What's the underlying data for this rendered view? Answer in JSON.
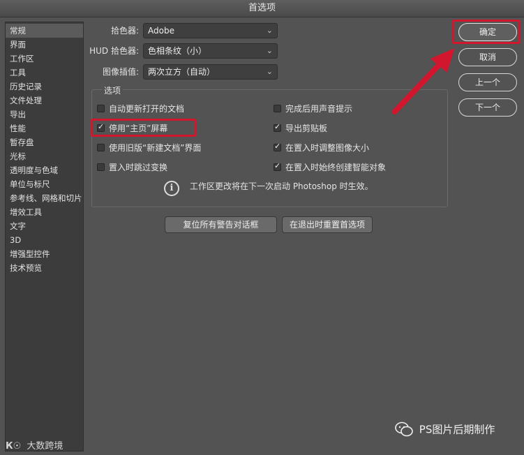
{
  "window": {
    "title": "首选项"
  },
  "sidebar": {
    "items": [
      {
        "label": "常规",
        "selected": true
      },
      {
        "label": "界面"
      },
      {
        "label": "工作区"
      },
      {
        "label": "工具"
      },
      {
        "label": "历史记录"
      },
      {
        "label": "文件处理"
      },
      {
        "label": "导出"
      },
      {
        "label": "性能"
      },
      {
        "label": "暂存盘"
      },
      {
        "label": "光标"
      },
      {
        "label": "透明度与色域"
      },
      {
        "label": "单位与标尺"
      },
      {
        "label": "参考线、网格和切片"
      },
      {
        "label": "增效工具"
      },
      {
        "label": "文字"
      },
      {
        "label": "3D"
      },
      {
        "label": "增强型控件"
      },
      {
        "label": "技术预览"
      }
    ]
  },
  "fields": {
    "color_picker": {
      "label": "拾色器:",
      "value": "Adobe"
    },
    "hud_color_picker": {
      "label": "HUD 拾色器:",
      "value": "色相条纹（小）"
    },
    "image_interpolation": {
      "label": "图像插值:",
      "value": "两次立方（自动）"
    }
  },
  "options": {
    "title": "选项",
    "items": [
      {
        "label": "自动更新打开的文档",
        "checked": false
      },
      {
        "label": "停用“主页”屏幕",
        "checked": true
      },
      {
        "label": "使用旧版“新建文档”界面",
        "checked": false
      },
      {
        "label": "置入时跳过变换",
        "checked": false
      },
      {
        "label": "完成后用声音提示",
        "checked": false
      },
      {
        "label": "导出剪贴板",
        "checked": true
      },
      {
        "label": "在置入时调整图像大小",
        "checked": true
      },
      {
        "label": "在置入时始终创建智能对象",
        "checked": true
      }
    ],
    "info_text": "工作区更改将在下一次启动 Photoshop 时生效。"
  },
  "buttons": {
    "reset_warnings": "复位所有警告对话框",
    "reset_on_quit": "在退出时重置首选项",
    "ok": "确定",
    "cancel": "取消",
    "prev": "上一个",
    "next": "下一个"
  },
  "watermarks": {
    "channel": "PS图片后期制作",
    "brand": "大数跨境"
  },
  "colors": {
    "highlight": "#d1162d",
    "background": "#535353",
    "sidebar": "#3c3c3c"
  }
}
